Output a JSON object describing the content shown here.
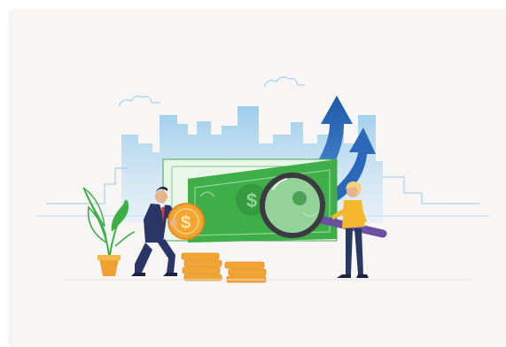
{
  "illustration": {
    "subject": "finance-investigation-illustration",
    "colors": {
      "card_background": "#f7f6f4",
      "skyline_blue": "#8ec6ea",
      "banknote_green": "#3fae49",
      "banknote_dark": "#2e8b38",
      "coin_orange": "#f2a533",
      "arrow_blue": "#2d67b7",
      "plant_green": "#3fae49",
      "pot_orange": "#f0a030",
      "suit_navy": "#2b3566",
      "jeans_navy": "#26395f",
      "sweater_yellow": "#f5b72e",
      "magnifier_rim": "#3a3a40",
      "handle_purple": "#6a4fa3"
    },
    "icons": [
      "dollar-sign-icon",
      "upward-arrow-icon",
      "magnifying-glass-icon"
    ]
  }
}
